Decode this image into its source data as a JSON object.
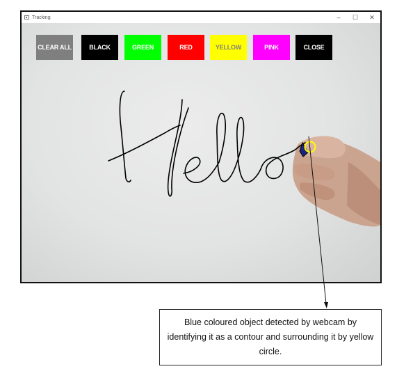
{
  "window": {
    "title": "Tracking",
    "controls": {
      "minimize": "–",
      "maximize": "☐",
      "close": "✕"
    }
  },
  "buttons": [
    {
      "id": "clear",
      "label": "CLEAR ALL",
      "bg": "#7f7f7f",
      "fg": "#ffffff"
    },
    {
      "id": "black",
      "label": "BLACK",
      "bg": "#000000",
      "fg": "#ffffff"
    },
    {
      "id": "green",
      "label": "GREEN",
      "bg": "#00ff00",
      "fg": "#ffffff"
    },
    {
      "id": "red",
      "label": "RED",
      "bg": "#ff0000",
      "fg": "#ffffff"
    },
    {
      "id": "yellow",
      "label": "YELLOW",
      "bg": "#ffff00",
      "fg": "#808080"
    },
    {
      "id": "pink",
      "label": "PINK",
      "bg": "#ff00ff",
      "fg": "#ffffff"
    },
    {
      "id": "close",
      "label": "CLOSE",
      "bg": "#000000",
      "fg": "#ffffff"
    }
  ],
  "canvas": {
    "stroke_color": "#000000",
    "tracker_color": "#ffff00",
    "marker_color": "#1a237e"
  },
  "callout": {
    "text": "Blue coloured object detected by webcam by identifying it as a contour and surrounding it by yellow circle."
  }
}
